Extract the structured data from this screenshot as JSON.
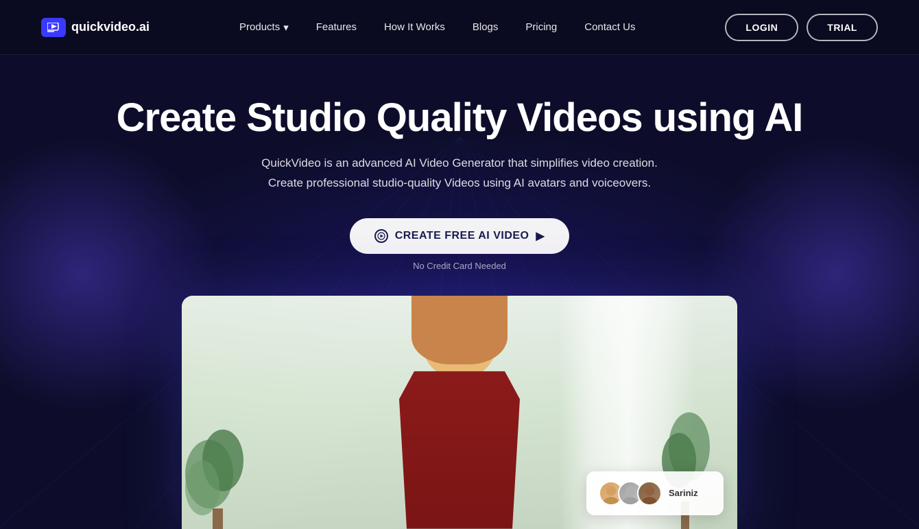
{
  "logo": {
    "text": "quickvideo.ai",
    "icon": "▶"
  },
  "nav": {
    "links": [
      {
        "label": "Products",
        "has_dropdown": true
      },
      {
        "label": "Features"
      },
      {
        "label": "How It Works"
      },
      {
        "label": "Blogs"
      },
      {
        "label": "Pricing"
      },
      {
        "label": "Contact Us"
      }
    ],
    "login_label": "LOGIN",
    "trial_label": "TRIAL"
  },
  "hero": {
    "title": "Create Studio Quality Videos using AI",
    "subtitle_line1": "QuickVideo is an advanced AI Video Generator that simplifies video creation.",
    "subtitle_line2": "Create professional studio-quality Videos using AI avatars and voiceovers.",
    "cta_button": "CREATE FREE AI VIDEO",
    "cta_arrow": "▶",
    "no_credit": "No Credit Card Needed"
  },
  "video_preview": {
    "avatar_panel_text": "Sariniz"
  },
  "colors": {
    "bg_dark": "#0d0d2b",
    "accent_blue": "#3a3aff",
    "nav_bg": "rgba(10,10,30,0.85)",
    "hero_title": "#ffffff",
    "cta_bg": "rgba(255,255,255,0.95)",
    "cta_text": "#1a1a4e"
  }
}
